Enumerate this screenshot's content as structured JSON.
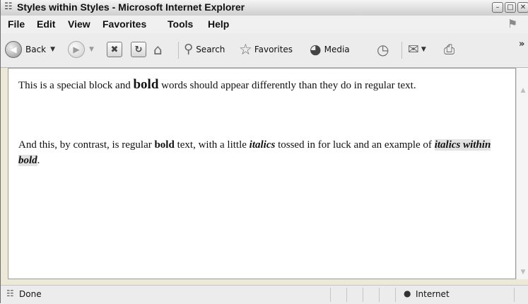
{
  "window": {
    "title": "Styles within Styles - Microsoft Internet Explorer"
  },
  "menu": {
    "items": [
      "File",
      "Edit",
      "View",
      "Favorites",
      "Tools",
      "Help"
    ]
  },
  "toolbar": {
    "back_label": "Back",
    "search_label": "Search",
    "favorites_label": "Favorites",
    "media_label": "Media",
    "overflow": "»"
  },
  "content": {
    "para1": {
      "pre": "This is a special block and ",
      "bold": "bold",
      "post": " words should appear differently than they do in regular text."
    },
    "para2": {
      "pre": "And this, by contrast, is regular ",
      "bold": "bold",
      "mid1": " text, with a little ",
      "italics": "italics",
      "mid2": " tossed in for luck and an example of ",
      "bold_italics": "italics within bold",
      "end": "."
    }
  },
  "status": {
    "left": "Done",
    "zone": "Internet"
  },
  "icons": [
    "ie-page-icon",
    "back-icon",
    "forward-icon",
    "stop-icon",
    "refresh-icon",
    "home-icon",
    "search-icon",
    "favorites-star-icon",
    "media-icon",
    "history-icon",
    "mail-icon",
    "print-icon",
    "windows-flag-icon",
    "globe-icon"
  ]
}
